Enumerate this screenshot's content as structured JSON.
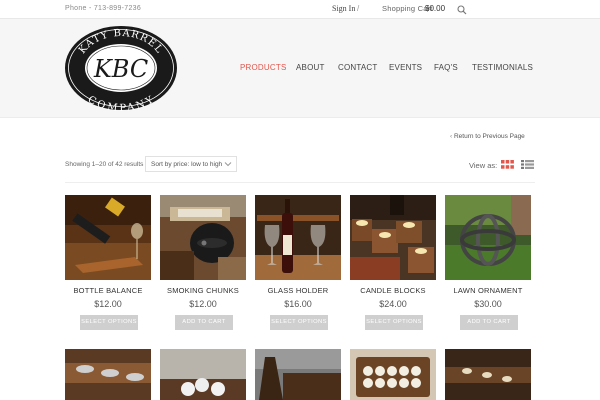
{
  "topbar": {
    "phone": "Phone - 713-899-7236",
    "sign_in": "Sign In",
    "separator": "/",
    "cart_link": "Shopping Cart",
    "cart_total": "$0.00"
  },
  "logo": {
    "top_text": "KATY BARREL",
    "monogram": "KBC",
    "bottom_text": "COMPANY"
  },
  "nav": {
    "items": [
      "PRODUCTS",
      "ABOUT",
      "CONTACT",
      "EVENTS",
      "FAQ'S",
      "TESTIMONIALS"
    ],
    "active_color": "#e2574c"
  },
  "shop": {
    "return_link": "Return to Previous Page",
    "results": "Showing 1–20 of 42 results",
    "sort_selected": "Sort by price: low to high",
    "view_as": "View as:",
    "active_view_color": "#e2574c"
  },
  "products": [
    {
      "name": "BOTTLE BALANCE",
      "price": "$12.00",
      "button": "SELECT OPTIONS"
    },
    {
      "name": "SMOKING CHUNKS",
      "price": "$12.00",
      "button": "ADD TO CART"
    },
    {
      "name": "GLASS HOLDER",
      "price": "$16.00",
      "button": "SELECT OPTIONS"
    },
    {
      "name": "CANDLE BLOCKS",
      "price": "$24.00",
      "button": "SELECT OPTIONS"
    },
    {
      "name": "LAWN ORNAMENT",
      "price": "$30.00",
      "button": "ADD TO CART"
    }
  ]
}
